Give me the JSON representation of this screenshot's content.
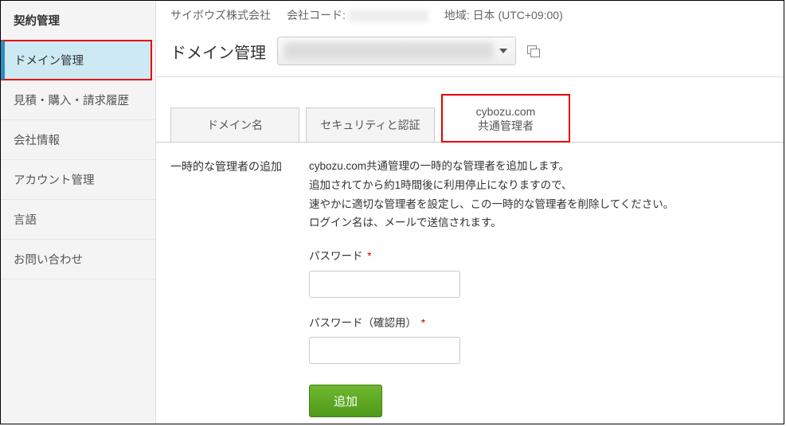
{
  "sidebar": {
    "header": "契約管理",
    "items": [
      "ドメイン管理",
      "見積・購入・請求履歴",
      "会社情報",
      "アカウント管理",
      "言語",
      "お問い合わせ"
    ],
    "active_index": 0
  },
  "topbar": {
    "company": "サイボウズ株式会社",
    "code_label": "会社コード:",
    "region_label": "地域:",
    "region_value": "日本 (UTC+09:00)"
  },
  "title": "ドメイン管理",
  "tabs": [
    {
      "line1": "ドメイン名"
    },
    {
      "line1": "セキュリティと認証"
    },
    {
      "line1": "cybozu.com",
      "line2": "共通管理者"
    }
  ],
  "active_tab_index": 2,
  "panel": {
    "label": "一時的な管理者の追加",
    "desc": [
      "cybozu.com共通管理の一時的な管理者を追加します。",
      "追加されてから約1時間後に利用停止になりますので、",
      "速やかに適切な管理者を設定し、この一時的な管理者を削除してください。",
      "ログイン名は、メールで送信されます。"
    ],
    "password_label": "パスワード",
    "password_confirm_label": "パスワード（確認用）",
    "required_mark": "*",
    "submit": "追加"
  }
}
